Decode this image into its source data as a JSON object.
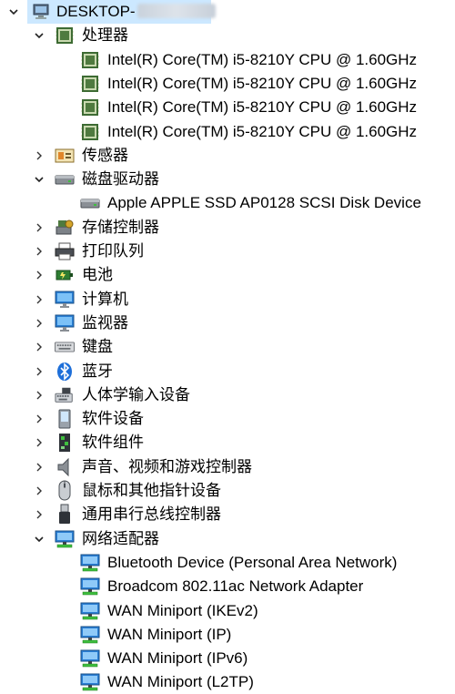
{
  "root": {
    "label": "DESKTOP-",
    "expanded": true
  },
  "categories": [
    {
      "label": "处理器",
      "icon": "processor-icon",
      "expanded": true,
      "children": [
        {
          "label": "Intel(R) Core(TM) i5-8210Y CPU @ 1.60GHz",
          "icon": "processor-icon"
        },
        {
          "label": "Intel(R) Core(TM) i5-8210Y CPU @ 1.60GHz",
          "icon": "processor-icon"
        },
        {
          "label": "Intel(R) Core(TM) i5-8210Y CPU @ 1.60GHz",
          "icon": "processor-icon"
        },
        {
          "label": "Intel(R) Core(TM) i5-8210Y CPU @ 1.60GHz",
          "icon": "processor-icon"
        }
      ]
    },
    {
      "label": "传感器",
      "icon": "sensor-icon",
      "expanded": false
    },
    {
      "label": "磁盘驱动器",
      "icon": "disk-drive-icon",
      "expanded": true,
      "children": [
        {
          "label": "Apple APPLE SSD AP0128 SCSI Disk Device",
          "icon": "disk-drive-icon"
        }
      ]
    },
    {
      "label": "存储控制器",
      "icon": "storage-controller-icon",
      "expanded": false
    },
    {
      "label": "打印队列",
      "icon": "printer-icon",
      "expanded": false
    },
    {
      "label": "电池",
      "icon": "battery-icon",
      "expanded": false
    },
    {
      "label": "计算机",
      "icon": "monitor-icon",
      "expanded": false
    },
    {
      "label": "监视器",
      "icon": "monitor-icon",
      "expanded": false
    },
    {
      "label": "键盘",
      "icon": "keyboard-icon",
      "expanded": false
    },
    {
      "label": "蓝牙",
      "icon": "bluetooth-icon",
      "expanded": false
    },
    {
      "label": "人体学输入设备",
      "icon": "hid-icon",
      "expanded": false
    },
    {
      "label": "软件设备",
      "icon": "software-device-icon",
      "expanded": false
    },
    {
      "label": "软件组件",
      "icon": "software-component-icon",
      "expanded": false
    },
    {
      "label": "声音、视频和游戏控制器",
      "icon": "speaker-icon",
      "expanded": false
    },
    {
      "label": "鼠标和其他指针设备",
      "icon": "mouse-icon",
      "expanded": false
    },
    {
      "label": "通用串行总线控制器",
      "icon": "usb-icon",
      "expanded": false
    },
    {
      "label": "网络适配器",
      "icon": "network-adapter-icon",
      "expanded": true,
      "children": [
        {
          "label": "Bluetooth Device (Personal Area Network)",
          "icon": "network-adapter-icon"
        },
        {
          "label": "Broadcom 802.11ac Network Adapter",
          "icon": "network-adapter-icon"
        },
        {
          "label": "WAN Miniport (IKEv2)",
          "icon": "network-adapter-icon"
        },
        {
          "label": "WAN Miniport (IP)",
          "icon": "network-adapter-icon"
        },
        {
          "label": "WAN Miniport (IPv6)",
          "icon": "network-adapter-icon"
        },
        {
          "label": "WAN Miniport (L2TP)",
          "icon": "network-adapter-icon"
        }
      ]
    }
  ]
}
